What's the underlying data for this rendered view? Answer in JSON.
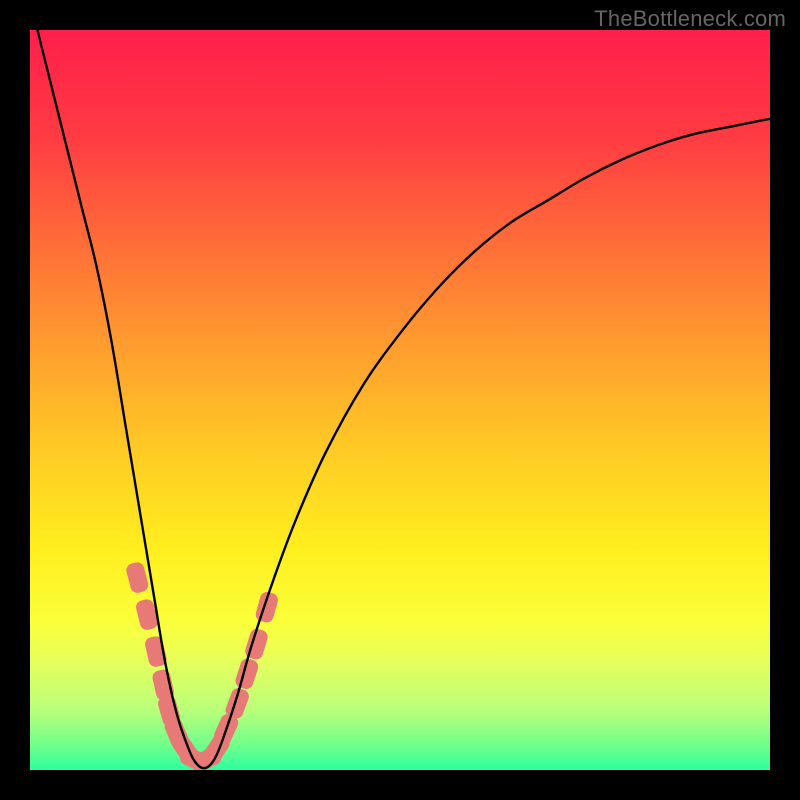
{
  "watermark": "TheBottleneck.com",
  "chart_data": {
    "type": "line",
    "title": "",
    "xlabel": "",
    "ylabel": "",
    "xlim": [
      0,
      100
    ],
    "ylim": [
      0,
      100
    ],
    "background_gradient": {
      "stops": [
        {
          "pct": 0,
          "color": "#ff1f4b"
        },
        {
          "pct": 14,
          "color": "#ff3a43"
        },
        {
          "pct": 28,
          "color": "#ff6a39"
        },
        {
          "pct": 42,
          "color": "#ff9a2f"
        },
        {
          "pct": 56,
          "color": "#ffc825"
        },
        {
          "pct": 70,
          "color": "#ffee1e"
        },
        {
          "pct": 80,
          "color": "#fbff3a"
        },
        {
          "pct": 85,
          "color": "#e8ff5a"
        },
        {
          "pct": 92,
          "color": "#b8ff7a"
        },
        {
          "pct": 97,
          "color": "#6aff8c"
        },
        {
          "pct": 100,
          "color": "#2bff9e"
        }
      ]
    },
    "series": [
      {
        "name": "bottleneck-curve",
        "color": "#000000",
        "stroke_width": 2.4,
        "x": [
          1,
          3,
          5,
          7,
          9,
          11,
          13,
          14,
          15,
          16,
          17,
          18,
          19,
          20,
          21,
          22,
          23,
          24,
          25,
          26,
          28,
          30,
          33,
          36,
          40,
          45,
          50,
          55,
          60,
          65,
          70,
          75,
          80,
          85,
          90,
          95,
          100
        ],
        "y": [
          100,
          92,
          84,
          76,
          68,
          58,
          46,
          40,
          34,
          28,
          22,
          16,
          11,
          7,
          4,
          1.6,
          0.4,
          0.4,
          1.6,
          4,
          10,
          17,
          26,
          34,
          43,
          52,
          59,
          65,
          70,
          74,
          77,
          80,
          82.5,
          84.5,
          86,
          87,
          88
        ]
      }
    ],
    "markers": {
      "color": "#e77a77",
      "shape": "rounded-pill",
      "rx": 7,
      "size": {
        "w": 18,
        "h": 30
      },
      "points": [
        {
          "x": 14.5,
          "y": 26
        },
        {
          "x": 15.8,
          "y": 21
        },
        {
          "x": 17.0,
          "y": 16
        },
        {
          "x": 18.0,
          "y": 11.5
        },
        {
          "x": 18.8,
          "y": 8
        },
        {
          "x": 19.8,
          "y": 5
        },
        {
          "x": 21.0,
          "y": 2.8
        },
        {
          "x": 22.3,
          "y": 1.4
        },
        {
          "x": 23.8,
          "y": 1.4
        },
        {
          "x": 25.2,
          "y": 2.8
        },
        {
          "x": 26.5,
          "y": 5.5
        },
        {
          "x": 28.0,
          "y": 9
        },
        {
          "x": 29.3,
          "y": 13
        },
        {
          "x": 30.6,
          "y": 17
        },
        {
          "x": 32.0,
          "y": 22
        }
      ]
    }
  }
}
